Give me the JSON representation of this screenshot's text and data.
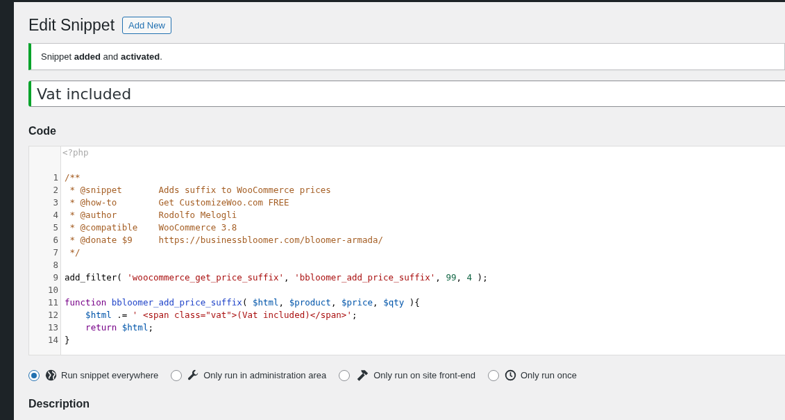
{
  "heading": {
    "title": "Edit Snippet",
    "add_button": "Add New"
  },
  "notice": {
    "text": "Snippet **added** and **activated**."
  },
  "snippet_title": {
    "value": "Vat included"
  },
  "code_section": {
    "heading": "Code",
    "opening_tag": "<?php",
    "lines": [
      {
        "number": "1",
        "tokens": [
          {
            "kind": "comment",
            "text": "/**"
          }
        ]
      },
      {
        "number": "2",
        "tokens": [
          {
            "kind": "comment",
            "text": " * @snippet       Adds suffix to WooCommerce prices"
          }
        ]
      },
      {
        "number": "3",
        "tokens": [
          {
            "kind": "comment",
            "text": " * @how-to        Get CustomizeWoo.com FREE"
          }
        ]
      },
      {
        "number": "4",
        "tokens": [
          {
            "kind": "comment",
            "text": " * @author        Rodolfo Melogli"
          }
        ]
      },
      {
        "number": "5",
        "tokens": [
          {
            "kind": "comment",
            "text": " * @compatible    WooCommerce 3.8"
          }
        ]
      },
      {
        "number": "6",
        "tokens": [
          {
            "kind": "comment",
            "text": " * @donate $9     https://businessbloomer.com/bloomer-armada/"
          }
        ]
      },
      {
        "number": "7",
        "tokens": [
          {
            "kind": "comment",
            "text": " */"
          }
        ]
      },
      {
        "number": "8"
      },
      {
        "number": "9",
        "tokens": [
          {
            "kind": "plain",
            "text": "add_filter( "
          },
          {
            "kind": "string",
            "text": "'woocommerce_get_price_suffix'"
          },
          {
            "kind": "plain",
            "text": ", "
          },
          {
            "kind": "string",
            "text": "'bbloomer_add_price_suffix'"
          },
          {
            "kind": "plain",
            "text": ", "
          },
          {
            "kind": "number",
            "text": "99"
          },
          {
            "kind": "plain",
            "text": ", "
          },
          {
            "kind": "number",
            "text": "4"
          },
          {
            "kind": "plain",
            "text": " );"
          }
        ]
      },
      {
        "number": "10"
      },
      {
        "number": "11",
        "tokens": [
          {
            "kind": "keyword",
            "text": "function "
          },
          {
            "kind": "def",
            "text": "bbloomer_add_price_suffix"
          },
          {
            "kind": "plain",
            "text": "( "
          },
          {
            "kind": "variable",
            "text": "$html"
          },
          {
            "kind": "plain",
            "text": ", "
          },
          {
            "kind": "variable",
            "text": "$product"
          },
          {
            "kind": "plain",
            "text": ", "
          },
          {
            "kind": "variable",
            "text": "$price"
          },
          {
            "kind": "plain",
            "text": ", "
          },
          {
            "kind": "variable",
            "text": "$qty"
          },
          {
            "kind": "plain",
            "text": " ){"
          }
        ]
      },
      {
        "number": "12",
        "tokens": [
          {
            "kind": "variable",
            "text": "    $html"
          },
          {
            "kind": "plain",
            "text": " .= "
          },
          {
            "kind": "string",
            "text": "' <span class=\"vat\">(Vat included)</span>'"
          },
          {
            "kind": "plain",
            "text": ";"
          }
        ]
      },
      {
        "number": "13",
        "tokens": [
          {
            "kind": "keyword",
            "text": "    return "
          },
          {
            "kind": "variable",
            "text": "$html"
          },
          {
            "kind": "plain",
            "text": ";"
          }
        ]
      },
      {
        "number": "14",
        "tokens": [
          {
            "kind": "plain",
            "text": "}"
          }
        ]
      }
    ]
  },
  "scope_options": [
    {
      "label": "Run snippet everywhere",
      "selected": true
    },
    {
      "label": "Only run in administration area",
      "selected": false
    },
    {
      "label": "Only run on site front-end",
      "selected": false
    },
    {
      "label": "Only run once",
      "selected": false
    }
  ],
  "description_heading": "Description"
}
